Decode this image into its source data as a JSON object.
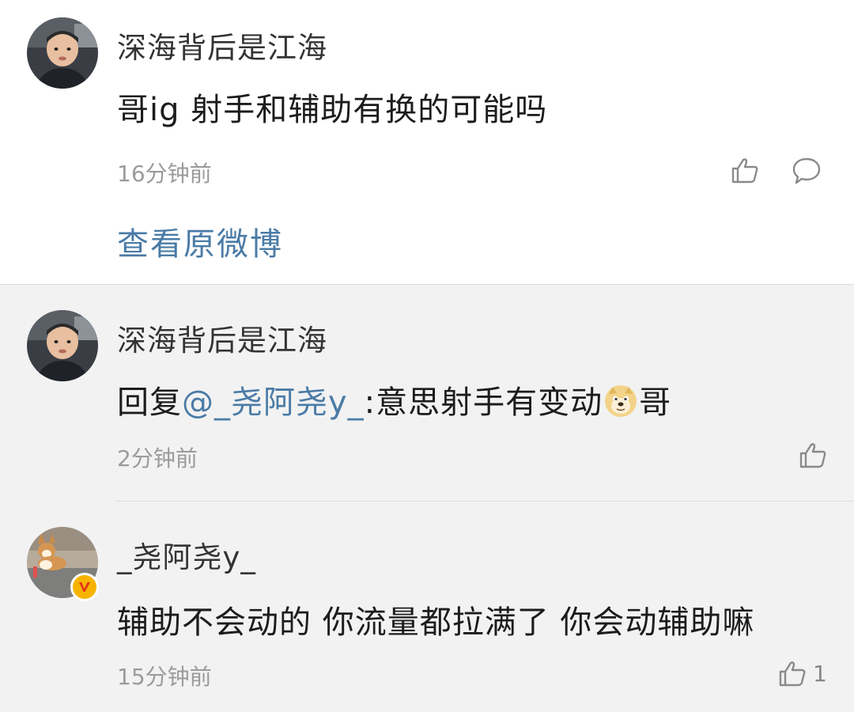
{
  "comments": [
    {
      "username": "深海背后是江海",
      "text": "哥ig 射手和辅助有换的可能吗",
      "time": "16分钟前",
      "view_original_label": "查看原微博"
    },
    {
      "username": "深海背后是江海",
      "reply_prefix": "回复",
      "mention": "@_尧阿尧y_",
      "reply_text": ":意思射手有变动",
      "emoji": "doge-emoji",
      "reply_suffix": "哥",
      "time": "2分钟前"
    },
    {
      "username": "_尧阿尧y_",
      "text": "辅助不会动的 你流量都拉满了 你会动辅助嘛",
      "time": "15分钟前",
      "like_count": "1",
      "badge": "verified-v-icon"
    }
  ],
  "colors": {
    "link": "#4a7ba6",
    "badge": "#f6b400",
    "muted": "#9b9b9b"
  }
}
